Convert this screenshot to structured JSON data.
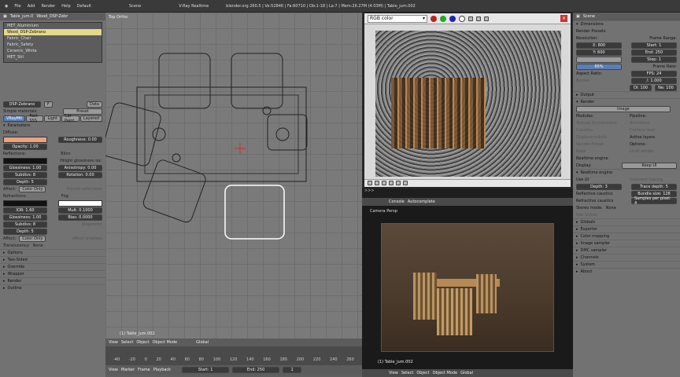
{
  "topbar": {
    "file": "File",
    "add": "Add",
    "render": "Render",
    "help": "Help",
    "layout": "Default",
    "scene": "Scene",
    "engine": "V-Ray Realtime",
    "info": "blender.org 260.5 | Ve:52846 | Fa:60710 | Ob:1-18 | La:7 | Mem:26.27M (4.03M) | Table_jum.002"
  },
  "left": {
    "object": "Table_jum.0",
    "material": "Wood_DSP-Zebr",
    "materials": [
      "MET_Aluminium",
      "Wood_DSP-Zebrano",
      "Fabric_Chair",
      "Fabric_Safety",
      "Ceramic_White",
      "MET_Stil"
    ],
    "data_label": "Data",
    "slot": "DSP-Zebrano",
    "slot_f": "F",
    "simple_materials": "Simple materials:",
    "preset": "Preset",
    "tabs": [
      "VRayMtl",
      "Fast SSS",
      "Light",
      "Car Paint",
      "Layered"
    ],
    "parameters": "Parameters",
    "diffuse": "Diffuse:",
    "roughness": "Roughness: 0.00",
    "opacity": "Opacity: 1.00",
    "reflections": "Reflections:",
    "blinn": "Blinn",
    "glossiness": "Glossiness: 1.00",
    "subdivs": "Subdivs: 8",
    "depth": "Depth: 5",
    "hilight": "Hilight glossiness loc.",
    "anisotropy": "Anisotropy: 0.00",
    "rotation": "Rotation: 0.00",
    "affect": "Affect:",
    "color_only": "Color Only",
    "fresnel": "Fresnel reflections",
    "refractions": "Refractions:",
    "fog": "Fog",
    "ior": "IOR: 1.60",
    "glossiness2": "Glossiness: 1.00",
    "subdivs2": "Subdivs: 8",
    "depth2": "Depth: 5",
    "mult": "Mult: 0.1000",
    "bias": "Bias: 0.0000",
    "dispersion": "Dispersion",
    "affect2": "Affect:",
    "color_only2": "Color Only",
    "affect_shadows": "Affect shadows",
    "translucency": "Translucency:",
    "none": "None",
    "collapsed": [
      "Options",
      "Two-Sided",
      "Override",
      "Wrapper",
      "Render",
      "Outline"
    ]
  },
  "viewport": {
    "label": "Top Ortho",
    "object": "(1) Table_jum.002",
    "view": "View",
    "select": "Select",
    "object_menu": "Object",
    "mode": "Object Mode",
    "global": "Global"
  },
  "timeline": {
    "view": "View",
    "marker": "Marker",
    "frame": "Frame",
    "playback": "Playback",
    "start": "Start: 1",
    "end": "End: 250",
    "current": "1",
    "ticks": [
      "-40",
      "-20",
      "0",
      "20",
      "40",
      "60",
      "80",
      "100",
      "120",
      "140",
      "160",
      "180",
      "200",
      "220",
      "240",
      "260"
    ]
  },
  "rgb": {
    "mode": "RGB color"
  },
  "console": {
    "prompt": ">>>",
    "tab_console": "Console",
    "tab_auto": "Autocomplete"
  },
  "camera": {
    "label": "Camera Persp",
    "object": "(1) Table_jum.002",
    "view": "View",
    "select": "Select",
    "object_menu": "Object",
    "mode": "Object Mode",
    "global": "Global"
  },
  "props": {
    "scene": "Scene",
    "dimensions": "Dimensions",
    "render_presets": "Render Presets",
    "resolution": "Resolution:",
    "res_x": "X: 800",
    "res_y": "Y: 600",
    "res_pct": "65%",
    "frame_range": "Frame Range:",
    "start": "Start: 1",
    "end": "End: 250",
    "step": "Step: 1",
    "aspect": "Aspect Ratio:",
    "border": "Border",
    "frame_rate": "Frame Rate:",
    "fps": "FPS: 24",
    "fps_base": "/: 1.000",
    "old": "Ol: 100",
    "new": "Ne: 100",
    "output": "Output",
    "render": "Render",
    "image": "Image",
    "modules": "Modules:",
    "pipeline": "Pipeline:",
    "modules_items": [
      "Texture Environment",
      "Caustics",
      "Displace subdiv",
      "Render Preset",
      "Bake"
    ],
    "pipeline_items": [
      "Animation",
      "Camera loop",
      "Active layers",
      "Options:",
      "Draft render"
    ],
    "realtime": "Realtime engine",
    "display": "Display:",
    "keep_ui": "Keep UI",
    "realtime_engine": "Realtime engine",
    "use_gi": "Use GI",
    "coherent": "Coherent tracing",
    "depth": "Depth: 3",
    "trace_depth": "Trace depth: 5",
    "reflective": "Reflective caustics",
    "bundle": "Bundle size: 128",
    "refractive": "Refractive caustics",
    "samples": "Samples per pixel: 4",
    "stereo": "Stereo mode:",
    "stereo_none": "None",
    "use_stereo": "Use Stereo",
    "sections": [
      "Globals",
      "Exporter",
      "Color mapping",
      "Image sampler",
      "DMC sampler",
      "Channels",
      "System",
      "About"
    ]
  }
}
